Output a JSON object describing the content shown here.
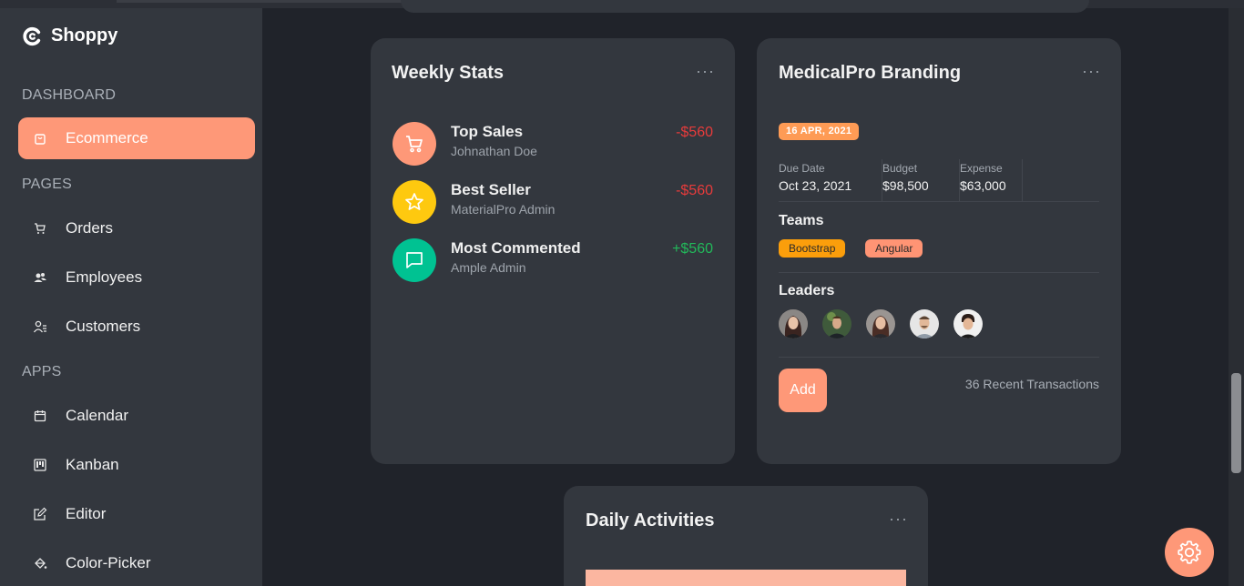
{
  "app": {
    "name": "Shoppy"
  },
  "sidebar": {
    "sections": {
      "dashboard": "DASHBOARD",
      "pages": "PAGES",
      "apps": "APPS"
    },
    "items": {
      "ecommerce": "Ecommerce",
      "orders": "Orders",
      "employees": "Employees",
      "customers": "Customers",
      "calendar": "Calendar",
      "kanban": "Kanban",
      "editor": "Editor",
      "color_picker": "Color-Picker"
    }
  },
  "weekly_stats": {
    "title": "Weekly Stats",
    "menu": "···",
    "rows": [
      {
        "title": "Top Sales",
        "subtitle": "Johnathan Doe",
        "amount": "-$560",
        "icon": "cart-icon",
        "color": "#fe9878"
      },
      {
        "title": "Best Seller",
        "subtitle": "MaterialPro Admin",
        "amount": "-$560",
        "icon": "star-icon",
        "color": "#fec90f"
      },
      {
        "title": "Most Commented",
        "subtitle": "Ample Admin",
        "amount": "+$560",
        "icon": "chat-bubble-icon",
        "color": "#00c292"
      }
    ]
  },
  "medicalpro": {
    "title": "MedicalPro Branding",
    "menu": "···",
    "date_badge": "16 APR, 2021",
    "due_date": {
      "label": "Due Date",
      "value": "Oct 23, 2021"
    },
    "budget": {
      "label": "Budget",
      "value": "$98,500"
    },
    "expense": {
      "label": "Expense",
      "value": "$63,000"
    },
    "teams_label": "Teams",
    "teams": [
      {
        "name": "Bootstrap",
        "color": "#fb9e0b"
      },
      {
        "name": "Angular",
        "color": "#ff9474"
      }
    ],
    "leaders_label": "Leaders",
    "add_label": "Add",
    "recent_transactions": "36 Recent Transactions"
  },
  "daily_activities": {
    "title": "Daily Activities",
    "menu": "···"
  },
  "colors": {
    "accent": "#fe9878",
    "sidebar": "#33373e",
    "background": "#20232a"
  }
}
